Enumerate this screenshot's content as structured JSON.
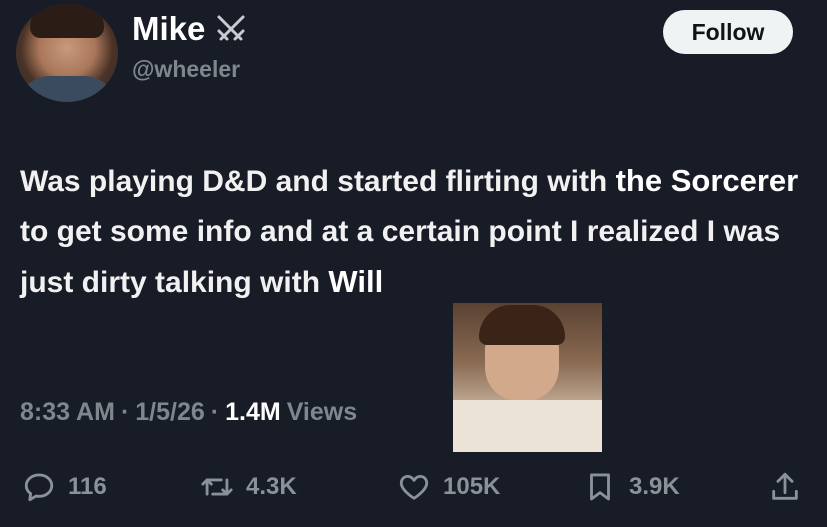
{
  "author": {
    "name": "Mike",
    "badge_icon": "crossed-swords-icon",
    "handle": "@wheeler"
  },
  "follow_label": "Follow",
  "tweet": {
    "part1": "Was playing D&D and started flirting with ",
    "highlight1": "the Sorcerer",
    "part2": " to get some info and at a certain point I realized I was just dirty talking with ",
    "highlight2": "Will"
  },
  "meta": {
    "time": "8:33 AM",
    "sep1": "·",
    "date": "1/5/26",
    "sep2": "·",
    "views_count": "1.4M",
    "views_label": "Views"
  },
  "actions": {
    "replies": "116",
    "retweets": "4.3K",
    "likes": "105K",
    "bookmarks": "3.9K"
  }
}
